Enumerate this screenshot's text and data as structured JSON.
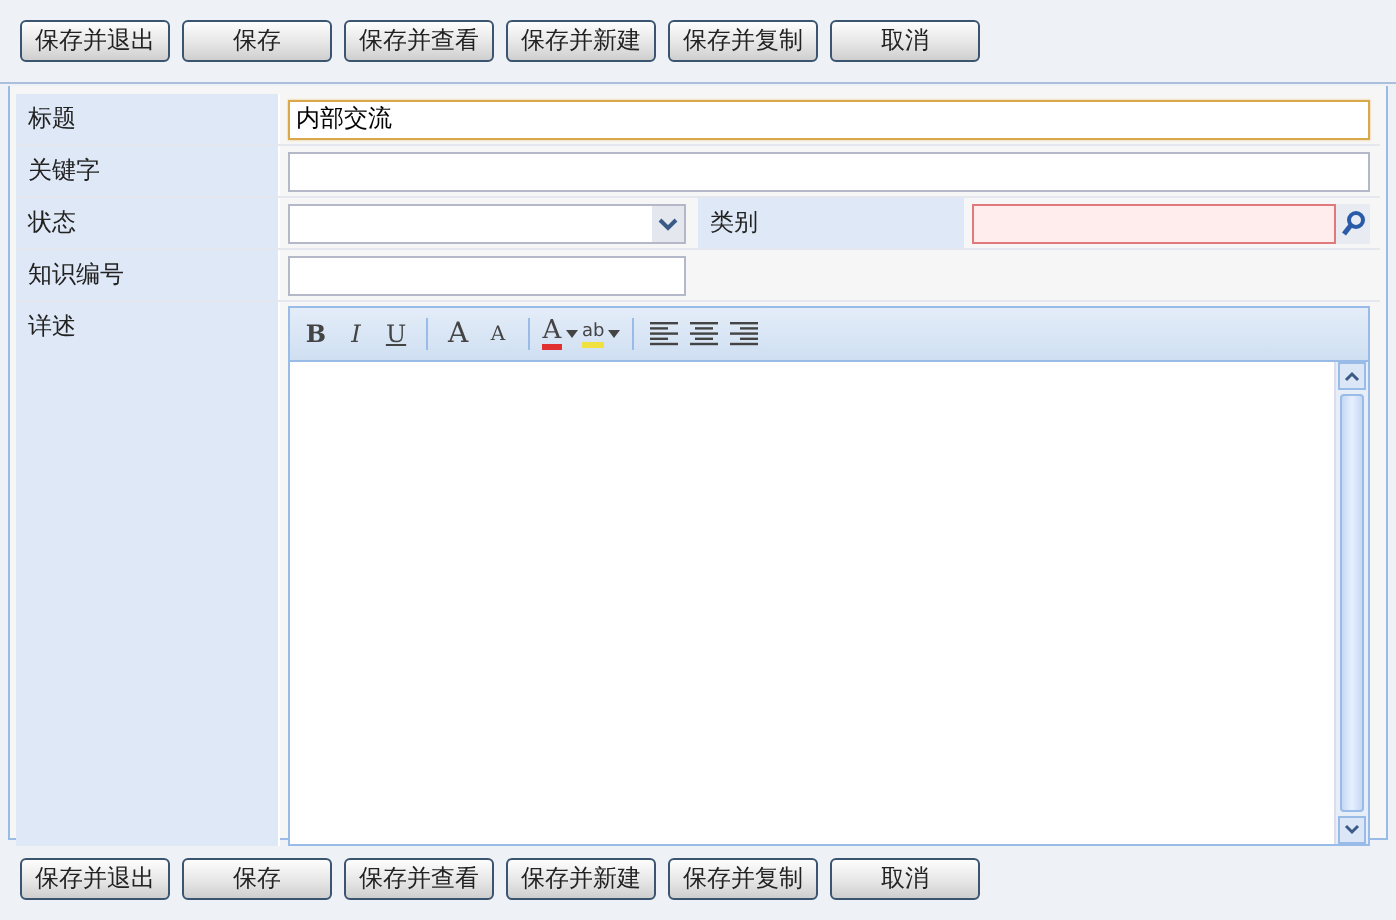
{
  "top_buttons": [
    "保存并退出",
    "保存",
    "保存并查看",
    "保存并新建",
    "保存并复制",
    "取消"
  ],
  "fields": [
    {
      "kind": "text",
      "label": "标题",
      "value": "内部交流",
      "focused": true
    },
    {
      "kind": "text",
      "label": "关键字",
      "focused": false
    },
    {
      "kind": "select",
      "label": "状态",
      "side_label": "类别",
      "side_invalid": true
    },
    {
      "kind": "short",
      "label": "知识编号",
      "focused": false
    },
    {
      "kind": "editor",
      "label": "详述"
    }
  ],
  "editor_toolbar": [
    [
      {
        "kind": "bold",
        "text": "B"
      },
      {
        "kind": "italic",
        "text": "I"
      },
      {
        "kind": "underline",
        "text": "U"
      }
    ],
    [
      {
        "kind": "grow",
        "text": "A"
      },
      {
        "kind": "shrink",
        "text": "A"
      }
    ],
    [
      {
        "kind": "fontcolor",
        "text": "A"
      },
      {
        "kind": "highlight",
        "text": "ab"
      }
    ],
    [
      {
        "kind": "align-left"
      },
      {
        "kind": "align-center"
      },
      {
        "kind": "align-right"
      }
    ]
  ],
  "bottom_buttons": [
    "保存并退出",
    "保存",
    "保存并查看",
    "保存并新建",
    "保存并复制",
    "取消"
  ]
}
